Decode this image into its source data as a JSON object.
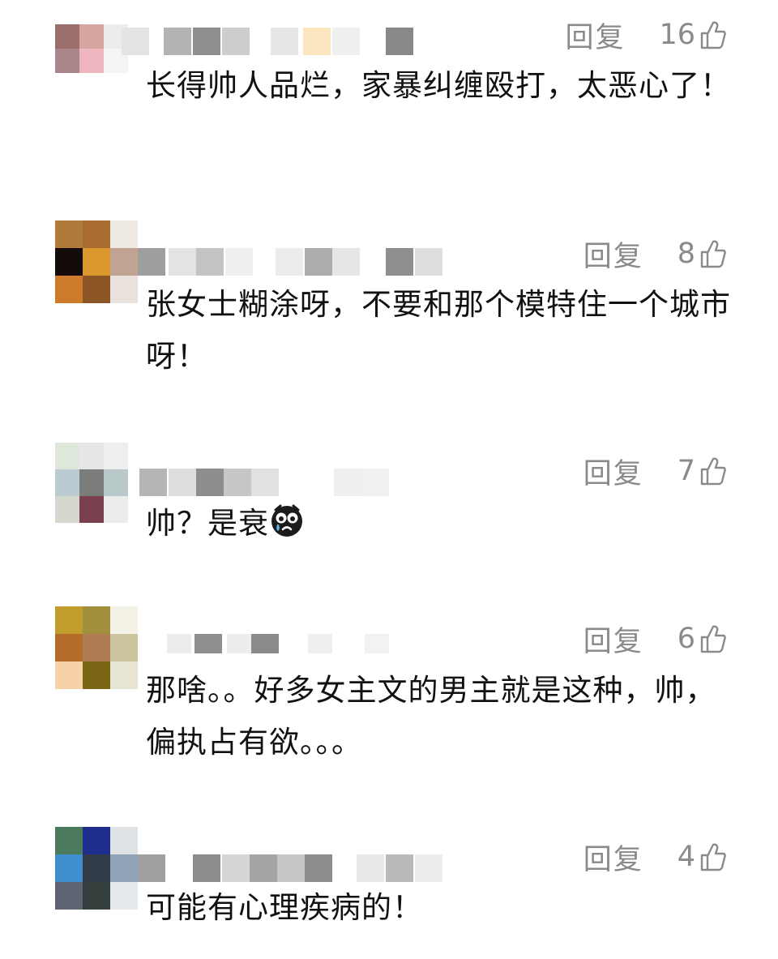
{
  "colors": {
    "meta_gray": "#8a8a8a",
    "text": "#111111",
    "background": "#ffffff"
  },
  "icons": {
    "like": "thumbs-up-outline-icon",
    "emoji": "crying-emoji-icon"
  },
  "comments": [
    {
      "reply_label": "回复",
      "likes": "16",
      "text": "长得帅人品烂，家暴纠缠殴打，太恶心了！"
    },
    {
      "reply_label": "回复",
      "likes": "8",
      "text": "张女士糊涂呀，不要和那个模特住一个城市呀！"
    },
    {
      "reply_label": "回复",
      "likes": "7",
      "text": "帅？是衰"
    },
    {
      "reply_label": "回复",
      "likes": "6",
      "text": "那啥。。好多女主文的男主就是这种，帅，偏执占有欲。。。"
    },
    {
      "reply_label": "回复",
      "likes": "4",
      "text": "可能有心理疾病的！"
    }
  ]
}
